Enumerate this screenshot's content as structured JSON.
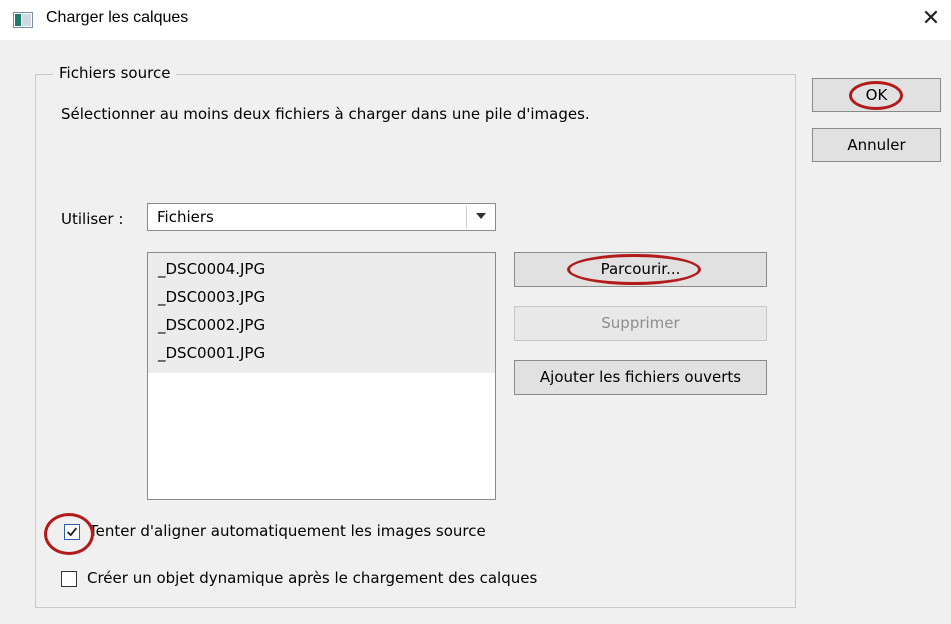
{
  "window": {
    "title": "Charger les calques",
    "close_symbol": "✕"
  },
  "source_files": {
    "group_title": "Fichiers source",
    "description": "Sélectionner au moins deux fichiers à charger dans une pile d'images.",
    "use_label": "Utiliser :",
    "use_selected": "Fichiers",
    "files": [
      "_DSC0004.JPG",
      "_DSC0003.JPG",
      "_DSC0002.JPG",
      "_DSC0001.JPG"
    ],
    "browse_label": "Parcourir...",
    "remove_label": "Supprimer",
    "add_open_label": "Ajouter les fichiers ouverts"
  },
  "options": {
    "auto_align_label": "Tenter d'aligner automatiquement les images source",
    "auto_align_checked": true,
    "smart_object_label": "Créer un objet dynamique après le chargement des calques",
    "smart_object_checked": false
  },
  "actions": {
    "ok_label": "OK",
    "cancel_label": "Annuler"
  },
  "colors": {
    "annotation": "#b31b1b",
    "checkbox_accent": "#2f5fa8"
  }
}
